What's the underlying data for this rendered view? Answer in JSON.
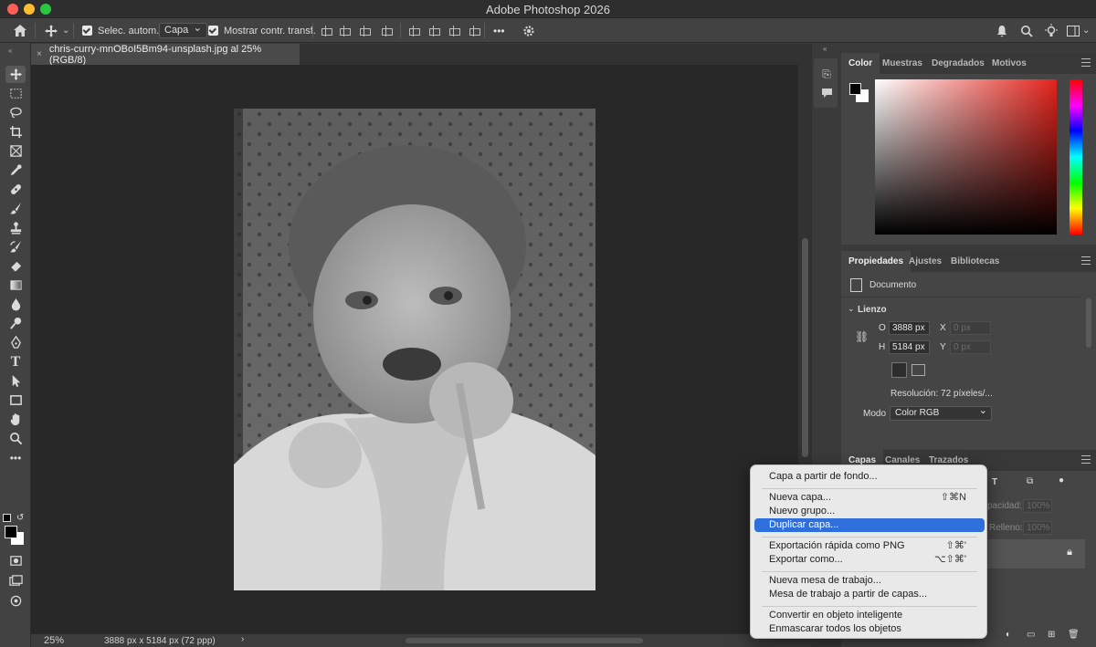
{
  "window": {
    "title": "Adobe Photoshop 2026"
  },
  "options_bar": {
    "auto_select_label": "Selec. autom.:",
    "auto_select_value": "Capa",
    "show_transform_label": "Mostrar contr. transf.",
    "more_label": "•••"
  },
  "document": {
    "tab_title": "chris-curry-mnOBoI5Bm94-unsplash.jpg al 25% (RGB/8)",
    "close_glyph": "×"
  },
  "status": {
    "zoom": "25%",
    "dimensions": "3888 px x 5184 px (72 ppp)",
    "arrow": "›"
  },
  "color_panel": {
    "tabs": [
      "Color",
      "Muestras",
      "Degradados",
      "Motivos"
    ],
    "active_tab": "Color",
    "foreground": "#000000",
    "background": "#ffffff"
  },
  "properties_panel": {
    "tabs": [
      "Propiedades",
      "Ajustes",
      "Bibliotecas"
    ],
    "section_doc": "Documento",
    "section_canvas": "Lienzo",
    "width_label": "O",
    "width_value": "3888 px",
    "height_label": "H",
    "height_value": "5184 px",
    "x_label": "X",
    "x_placeholder": "0 px",
    "y_label": "Y",
    "y_placeholder": "0 px",
    "resolution": "Resolución: 72 píxeles/...",
    "mode_label": "Modo",
    "mode_value": "Color RGB"
  },
  "layers_panel": {
    "tabs": [
      "Capas",
      "Canales",
      "Trazados"
    ],
    "opacity_label": "pacidad:",
    "opacity_value": "100%",
    "fill_label": "Relleno:",
    "fill_value": "100%"
  },
  "context_menu": {
    "items": [
      {
        "label": "Capa a partir de fondo...",
        "shortcut": ""
      },
      {
        "label": "Nueva capa...",
        "shortcut": "⇧⌘N"
      },
      {
        "label": "Nuevo grupo...",
        "shortcut": ""
      },
      {
        "label": "Duplicar capa...",
        "shortcut": "",
        "highlighted": true
      },
      {
        "label": "Exportación rápida como PNG",
        "shortcut": "⇧⌘'"
      },
      {
        "label": "Exportar como...",
        "shortcut": "⌥⇧⌘'"
      },
      {
        "label": "Nueva mesa de trabajo...",
        "shortcut": ""
      },
      {
        "label": "Mesa de trabajo a partir de capas...",
        "shortcut": ""
      },
      {
        "label": "Convertir en objeto inteligente",
        "shortcut": ""
      },
      {
        "label": "Enmascarar todos los objetos",
        "shortcut": ""
      }
    ]
  },
  "colors": {
    "accent": "#2f6fdc",
    "canvas_bg": "#282828",
    "panel_bg": "#454545"
  }
}
